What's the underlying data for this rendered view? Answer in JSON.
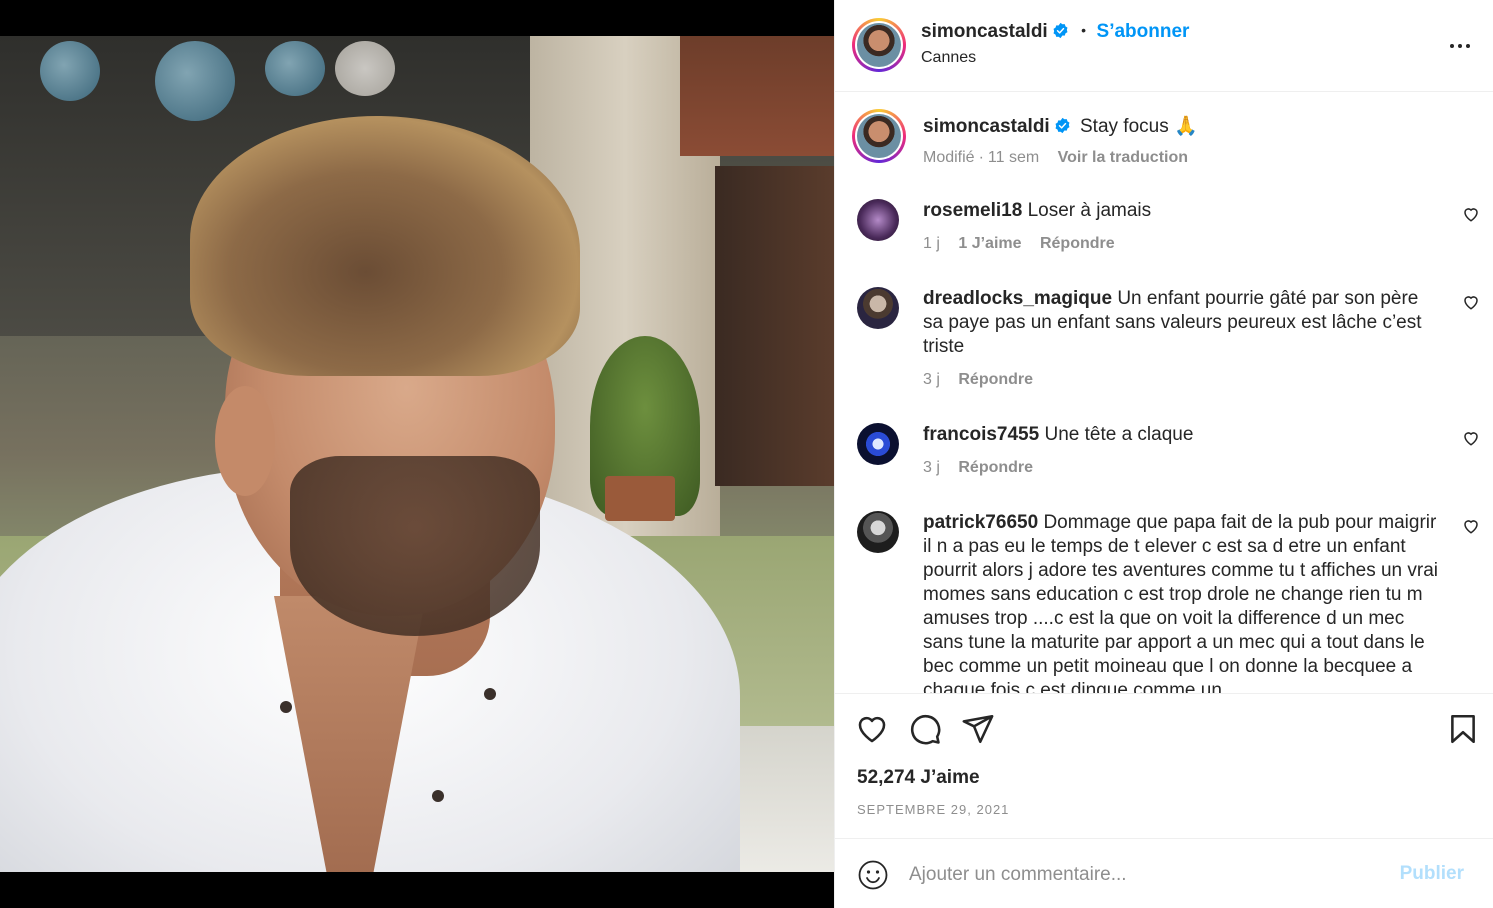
{
  "post": {
    "author": "simoncastaldi",
    "subscribe_label": "S’abonner",
    "dot": "•",
    "location": "Cannes",
    "caption_text": "Stay focus 🙏",
    "caption_meta_edited": "Modifié",
    "caption_meta_sep": "·",
    "caption_meta_time": "11 sem",
    "translate_label": "Voir la traduction",
    "more_icon": "more-horizontal-icon"
  },
  "comments": [
    {
      "username": "rosemeli18",
      "text": "Loser à jamais",
      "time": "1 j",
      "likes": "1 J’aime",
      "reply": "Répondre"
    },
    {
      "username": "dreadlocks_magique",
      "text": "Un enfant pourrie gâté par son père sa paye pas un enfant sans valeurs peureux est lâche c’est triste",
      "time": "3 j",
      "reply": "Répondre"
    },
    {
      "username": "francois7455",
      "text": "Une tête a claque",
      "time": "3 j",
      "reply": "Répondre"
    },
    {
      "username": "patrick76650",
      "text": "Dommage que papa fait de la pub pour maigrir il n a pas eu le temps de t elever c est sa d etre un enfant pourrit alors j adore tes aventures comme tu t affiches un vrai momes sans education c est trop drole ne change rien tu m amuses trop ....c est la que on voit la difference d un mec sans tune la maturite par apport a un mec qui a tout dans le bec comme un petit moineau que l on donne la becquee a chaque fois c est dingue comme un"
    }
  ],
  "actions": {
    "like_count": "52,274 J’aime",
    "date": "SEPTEMBRE 29, 2021"
  },
  "composer": {
    "placeholder": "Ajouter un commentaire...",
    "publish_label": "Publier"
  },
  "colors": {
    "accent": "#0095f6",
    "muted": "#8e8e8e",
    "publish_disabled": "#b2dffc"
  }
}
